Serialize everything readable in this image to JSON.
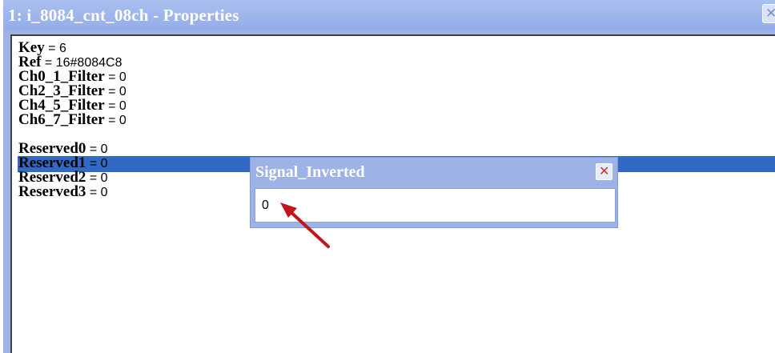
{
  "window": {
    "title": "1: i_8084_cnt_08ch - Properties",
    "close_glyph": "✕"
  },
  "properties": [
    {
      "name": "Key",
      "value": "6"
    },
    {
      "name": "Ref",
      "value": "16#8084C8"
    },
    {
      "name": "Ch0_1_Filter",
      "value": "0"
    },
    {
      "name": "Ch2_3_Filter",
      "value": "0"
    },
    {
      "name": "Ch4_5_Filter",
      "value": "0"
    },
    {
      "name": "Ch6_7_Filter",
      "value": "0"
    },
    {
      "name": "Signal_Inverted",
      "value": "0",
      "selected": true
    },
    {
      "name": "Reserved0",
      "value": "0"
    },
    {
      "name": "Reserved1",
      "value": "0"
    },
    {
      "name": "Reserved2",
      "value": "0"
    },
    {
      "name": "Reserved3",
      "value": "0"
    }
  ],
  "editor": {
    "title": "Signal_Inverted",
    "value": "0",
    "close_glyph": "✕"
  },
  "colors": {
    "selection": "#316ac5",
    "titlebar": "#9db2e6",
    "arrow": "#c0151b"
  },
  "icons": {
    "window_close": "close-icon",
    "editor_close": "close-icon",
    "annotation": "red-arrow-icon"
  }
}
